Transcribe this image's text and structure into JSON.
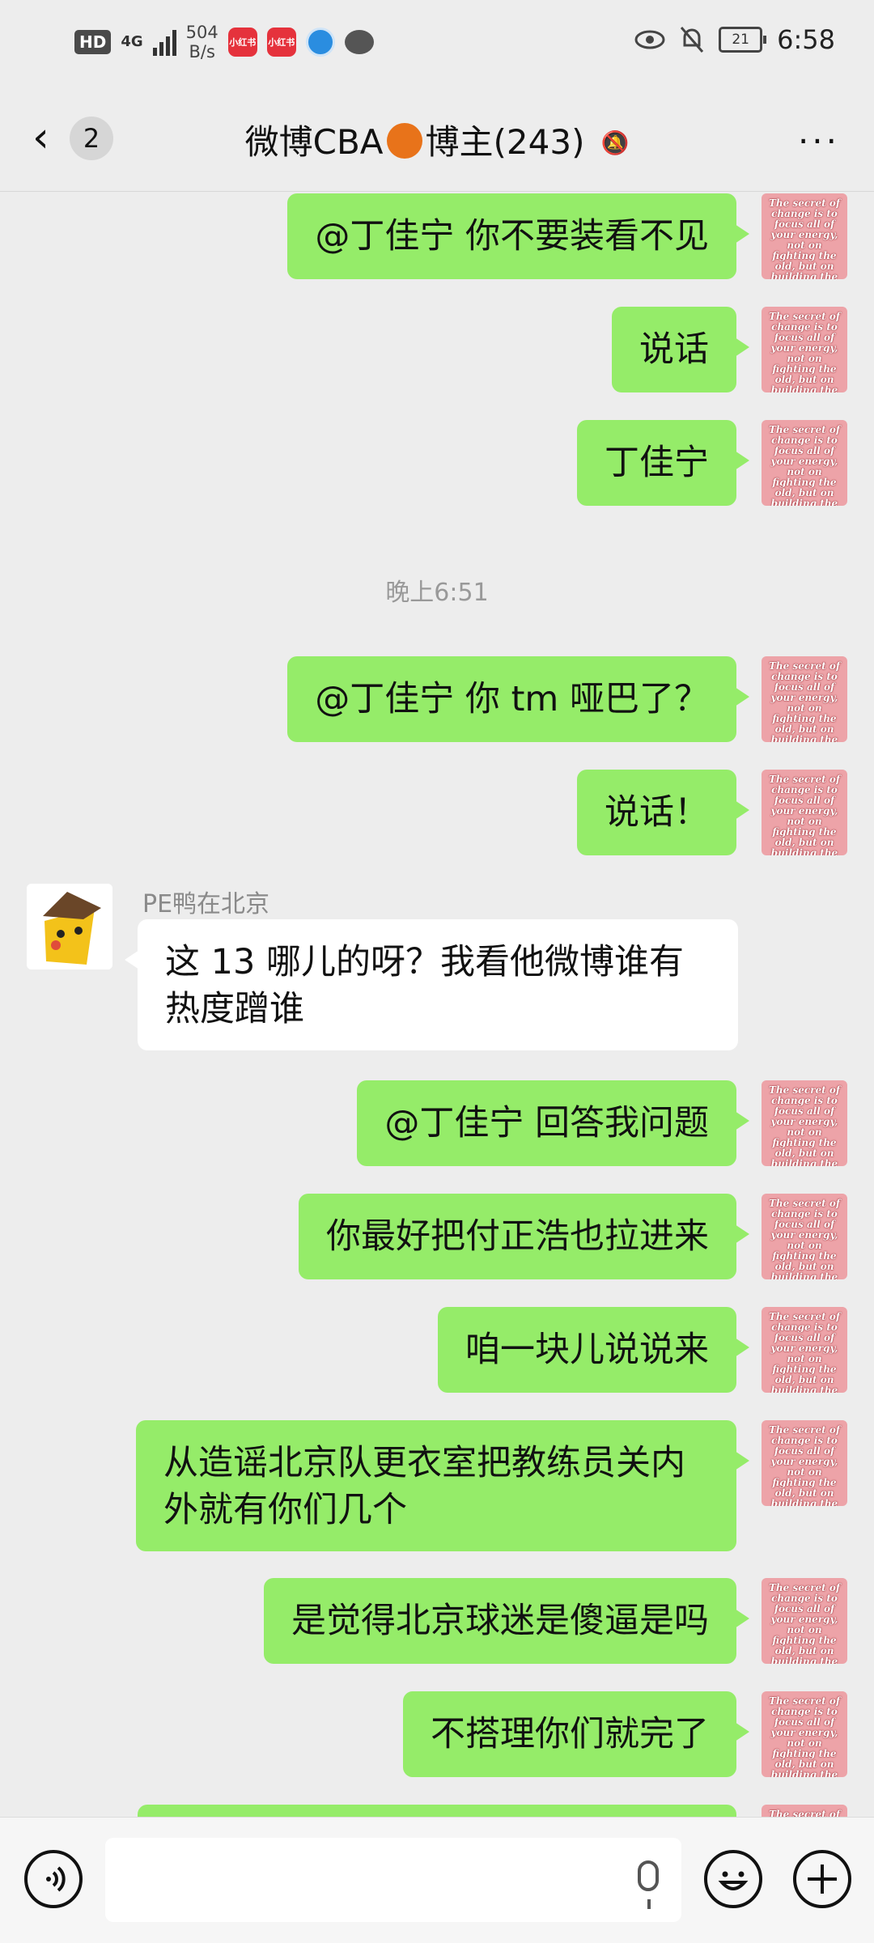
{
  "status_bar": {
    "hd": "HD",
    "network": "4G",
    "speed_value": "504",
    "speed_unit": "B/s",
    "app1": "小红书",
    "app2": "小红书",
    "battery": "21",
    "time": "6:58"
  },
  "header": {
    "back_badge": "2",
    "title_before": "微博CBA",
    "title_after": "博主(243)",
    "more": "···"
  },
  "avatar_text": "The secret of change is to focus all of your energy, not on fighting the old, but on building the new.",
  "messages": [
    {
      "type": "sent",
      "text": "@丁佳宁  你不要装看不见"
    },
    {
      "type": "sent",
      "text": "说话"
    },
    {
      "type": "sent",
      "text": "丁佳宁"
    },
    {
      "type": "time",
      "text": "晚上6:51"
    },
    {
      "type": "sent",
      "text": "@丁佳宁  你 tm 哑巴了？"
    },
    {
      "type": "sent",
      "text": "说话！"
    },
    {
      "type": "received",
      "sender": "PE鸭在北京",
      "text": "这 13 哪儿的呀？我看他微博谁有热度蹭谁"
    },
    {
      "type": "sent",
      "text": "@丁佳宁  回答我问题"
    },
    {
      "type": "sent",
      "text": "你最好把付正浩也拉进来"
    },
    {
      "type": "sent",
      "text": "咱一块儿说说来"
    },
    {
      "type": "sent",
      "text": "从造谣北京队更衣室把教练员关内外就有你们几个"
    },
    {
      "type": "sent",
      "text": "是觉得北京球迷是傻逼是吗"
    },
    {
      "type": "sent",
      "text": "不搭理你们就完了"
    }
  ],
  "colors": {
    "sent_bubble": "#95ec69",
    "received_bubble": "#ffffff",
    "background": "#ededed"
  }
}
